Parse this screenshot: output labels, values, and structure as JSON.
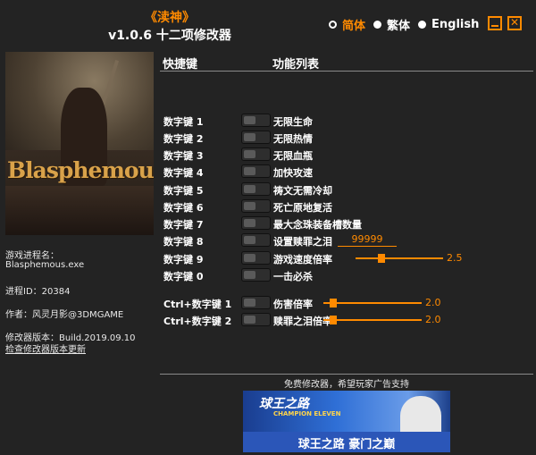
{
  "app": {
    "game_title": "《渎神》",
    "subtitle": "v1.0.6 十二项修改器"
  },
  "languages": [
    {
      "label": "简体",
      "active": true
    },
    {
      "label": "繁体",
      "active": false
    },
    {
      "label": "English",
      "active": false
    }
  ],
  "window": {
    "close_glyph": "✕"
  },
  "cover": {
    "logo_text": "Blasphemous"
  },
  "info": {
    "process_label": "游戏进程名：",
    "process_name": "Blasphemous.exe",
    "pid": "进程ID：20384",
    "author": "作者：风灵月影@3DMGAME",
    "version": "修改器版本：Build.2019.09.10",
    "check_update": "检查修改器版本更新"
  },
  "headers": {
    "hotkey": "快捷键",
    "function": "功能列表"
  },
  "cheats": [
    {
      "key": "数字键 1",
      "label": "无限生命"
    },
    {
      "key": "数字键 2",
      "label": "无限热情"
    },
    {
      "key": "数字键 3",
      "label": "无限血瓶"
    },
    {
      "key": "数字键 4",
      "label": "加快攻速"
    },
    {
      "key": "数字键 5",
      "label": "祷文无需冷却"
    },
    {
      "key": "数字键 6",
      "label": "死亡原地复活"
    },
    {
      "key": "数字键 7",
      "label": "最大念珠装备槽数量"
    },
    {
      "key": "数字键 8",
      "label": "设置赎罪之泪",
      "value": "99999"
    },
    {
      "key": "数字键 9",
      "label": "游戏速度倍率",
      "slider_value": "2.5",
      "level": 0.3
    },
    {
      "key": "数字键 0",
      "label": "一击必杀"
    },
    {
      "key": "Ctrl+数字键 1",
      "label": "伤害倍率",
      "slider_value": "2.0",
      "level": 0.1
    },
    {
      "key": "Ctrl+数字键 2",
      "label": "赎罪之泪倍率",
      "slider_value": "2.0",
      "level": 0.1
    }
  ],
  "footer": {
    "ad_text": "免费修改器，希望玩家广告支持",
    "banner_title": "球王之路",
    "banner_sub": "CHAMPION ELEVEN",
    "banner_slogan": "球王之路 豪门之巅"
  },
  "colors": {
    "accent": "#ff8a00",
    "background": "#232323"
  }
}
